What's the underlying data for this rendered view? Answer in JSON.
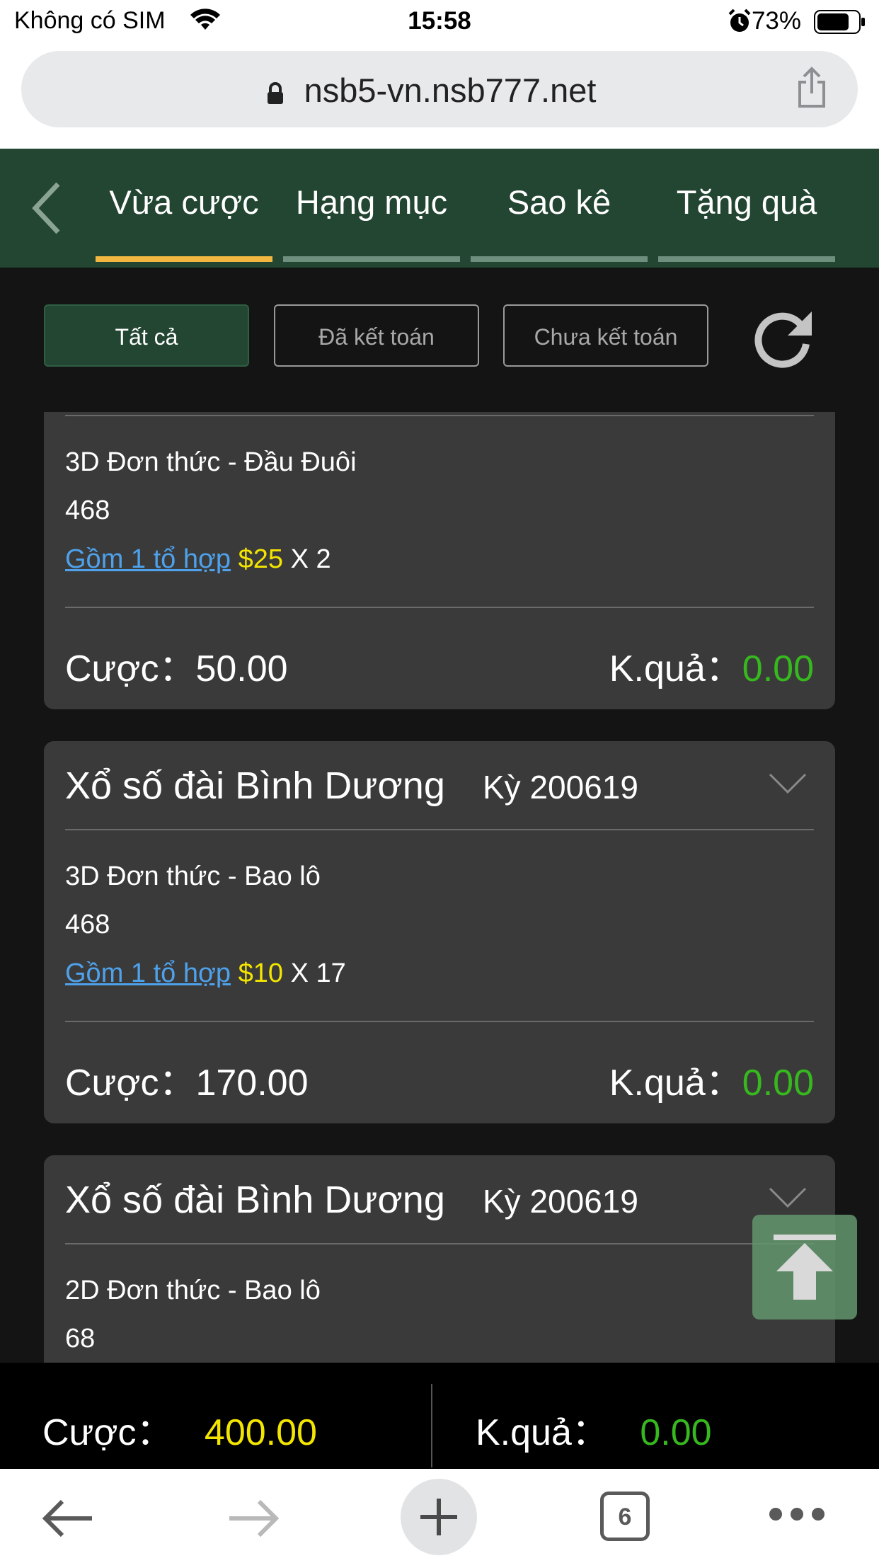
{
  "status_bar": {
    "carrier": "Không có SIM",
    "time": "15:58",
    "battery": "73%"
  },
  "browser": {
    "url": "nsb5-vn.nsb777.net",
    "tab_count": "6"
  },
  "nav": {
    "tabs": [
      "Vừa cược",
      "Hạng mục",
      "Sao kê",
      "Tặng quà"
    ],
    "active": 0
  },
  "filters": {
    "all": "Tất cả",
    "settled": "Đã kết toán",
    "unsettled": "Chưa kết toán"
  },
  "cards": [
    {
      "bet_type": "3D Đơn thức - Đầu Đuôi",
      "number": "468",
      "combo_link": "Gồm 1 tổ hợp",
      "unit": "$25",
      "mult": "X 2",
      "bet_label": "Cược：",
      "bet_value": "50.00",
      "result_label": "K.quả：",
      "result_value": "0.00"
    },
    {
      "title": "Xổ số đài Bình Dương",
      "period": "Kỳ 200619",
      "bet_type": "3D Đơn thức - Bao lô",
      "number": "468",
      "combo_link": "Gồm 1 tổ hợp",
      "unit": "$10",
      "mult": "X 17",
      "bet_label": "Cược：",
      "bet_value": "170.00",
      "result_label": "K.quả：",
      "result_value": "0.00"
    },
    {
      "title": "Xổ số đài Bình Dương",
      "period": "Kỳ 200619",
      "bet_type": "2D Đơn thức - Bao lô",
      "number": "68"
    }
  ],
  "summary": {
    "bet_label": "Cược：",
    "bet_value": "400.00",
    "result_label": "K.quả：",
    "result_value": "0.00"
  }
}
